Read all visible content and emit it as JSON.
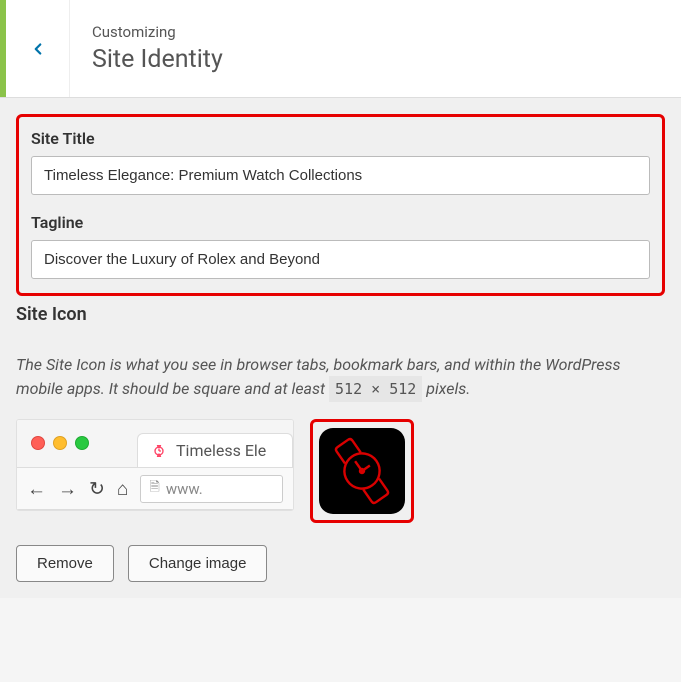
{
  "header": {
    "breadcrumb": "Customizing",
    "section_title": "Site Identity"
  },
  "fields": {
    "site_title_label": "Site Title",
    "site_title_value": "Timeless Elegance: Premium Watch Collections",
    "tagline_label": "Tagline",
    "tagline_value": "Discover the Luxury of Rolex and Beyond"
  },
  "site_icon": {
    "label": "Site Icon",
    "desc_pre": "The Site Icon is what you see in browser tabs, bookmark bars, and within the WordPress mobile apps. It should be square and at least ",
    "desc_dim": "512 × 512",
    "desc_post": " pixels."
  },
  "browser_preview": {
    "tab_text": "Timeless Ele",
    "url_text": "www."
  },
  "buttons": {
    "remove": "Remove",
    "change": "Change image"
  }
}
